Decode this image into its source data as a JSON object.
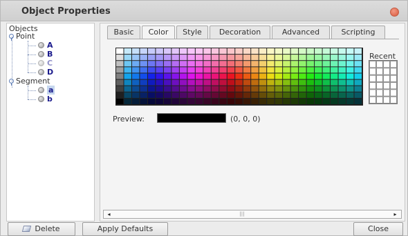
{
  "window": {
    "title": "Object Properties"
  },
  "tree": {
    "root_label": "Objects",
    "groups": [
      {
        "label": "Point",
        "items": [
          {
            "label": "A",
            "visible": true
          },
          {
            "label": "B",
            "visible": true
          },
          {
            "label": "C",
            "visible": false
          },
          {
            "label": "D",
            "visible": true
          }
        ]
      },
      {
        "label": "Segment",
        "items": [
          {
            "label": "a",
            "visible": true,
            "selected": true
          },
          {
            "label": "b",
            "visible": true
          }
        ]
      }
    ]
  },
  "tabs": [
    {
      "label": "Basic"
    },
    {
      "label": "Color",
      "active": true
    },
    {
      "label": "Style"
    },
    {
      "label": "Decoration"
    },
    {
      "label": "Advanced"
    },
    {
      "label": "Scripting"
    }
  ],
  "color_panel": {
    "recent_label": "Recent",
    "preview_label": "Preview:",
    "preview_color": "#000000",
    "preview_rgb": "(0, 0, 0)"
  },
  "scrollbar": {
    "left_arrow": "◂",
    "right_arrow": "▸",
    "thumb": "|||"
  },
  "buttons": {
    "delete": "Delete",
    "apply_defaults": "Apply Defaults",
    "close": "Close"
  }
}
